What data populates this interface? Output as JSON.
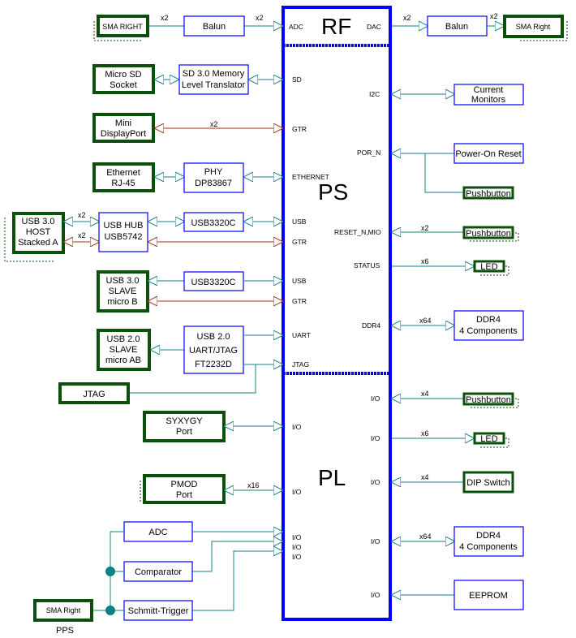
{
  "colors": {
    "chip_border": "#0000ff",
    "connector_border": "#0b4f0b",
    "signal_teal": "#0f8080",
    "signal_gtr": "#a03010",
    "shadow_dash": "#0b4f0b"
  },
  "chip": {
    "sections": {
      "rf": "RF",
      "ps": "PS",
      "pl": "PL"
    },
    "rf_pins": {
      "left": "ADC",
      "right": "DAC"
    },
    "ps_left_pins": [
      "SD",
      "GTR",
      "ETHERNET",
      "USB",
      "GTR",
      "USB",
      "GTR",
      "UART",
      "JTAG"
    ],
    "ps_right_pins": [
      "I2C",
      "POR_N",
      "RESET_N,MIO",
      "STATUS",
      "DDR4"
    ],
    "pl_left_pins": [
      "I/O",
      "I/O",
      "I/O",
      "I/O",
      "I/O"
    ],
    "pl_right_pins": [
      "I/O",
      "I/O",
      "I/O",
      "I/O",
      "I/O"
    ]
  },
  "left_blocks": {
    "sma_right_rf": "SMA RIGHT",
    "balun_left": "Balun",
    "micro_sd_l1": "Micro SD",
    "micro_sd_l2": "Socket",
    "sd_translator_l1": "SD 3.0 Memory",
    "sd_translator_l2": "Level Translator",
    "mini_dp_l1": "Mini",
    "mini_dp_l2": "DisplayPort",
    "ethernet_l1": "Ethernet",
    "ethernet_l2": "RJ-45",
    "phy_l1": "PHY",
    "phy_l2": "DP83867",
    "usb_host_l1": "USB 3.0",
    "usb_host_l2": "HOST",
    "usb_host_l3": "Stacked A",
    "usb_hub_l1": "USB HUB",
    "usb_hub_l2": "USB5742",
    "usb3320c_a": "USB3320C",
    "usb3320c_b": "USB3320C",
    "usb_slave_l1": "USB 3.0",
    "usb_slave_l2": "SLAVE",
    "usb_slave_l3": "micro B",
    "usb2_slave_l1": "USB 2.0",
    "usb2_slave_l2": "SLAVE",
    "usb2_slave_l3": "micro AB",
    "ft_l1": "USB 2.0",
    "ft_l2": "UART/JTAG",
    "ft_l3": "FT2232D",
    "jtag": "JTAG",
    "syzygy_l1": "SYXYGY",
    "syzygy_l2": "Port",
    "pmod_l1": "PMOD",
    "pmod_l2": "Port",
    "adc": "ADC",
    "comparator": "Comparator",
    "schmitt": "Schmitt-Trigger",
    "sma_right_pps": "SMA Right",
    "pps_label": "PPS"
  },
  "right_blocks": {
    "balun_right": "Balun",
    "sma_right_dac": "SMA Right",
    "current_l1": "Current",
    "current_l2": "Monitors",
    "por": "Power-On Reset",
    "pushbutton_por": "Pushbutton",
    "pushbutton_reset": "Pushbutton",
    "led_status": "LED",
    "ddr4_ps_l1": "DDR4",
    "ddr4_ps_l2": "4 Components",
    "pushbutton_pl": "Pushbutton",
    "led_pl": "LED",
    "dip_switch": "DIP Switch",
    "ddr4_pl_l1": "DDR4",
    "ddr4_pl_l2": "4 Components",
    "eeprom": "EEPROM"
  },
  "bus_widths": {
    "sma_balun_left": "x2",
    "balun_adc": "x2",
    "dac_balun": "x2",
    "balun_sma_right": "x2",
    "mini_dp": "x2",
    "usb_host_usb": "x2",
    "usb_host_gtr": "x2",
    "reset_mio": "x2",
    "status_led": "x6",
    "ddr4_ps": "x64",
    "pl_pushbutton": "x4",
    "pl_led": "x6",
    "pl_dip": "x4",
    "ddr4_pl": "x64",
    "pmod": "x16"
  }
}
